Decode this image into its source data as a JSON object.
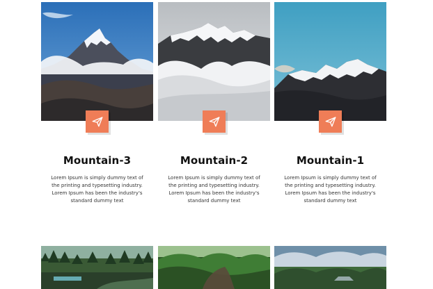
{
  "cards": [
    {
      "title": "Mountain-3",
      "description": "Lorem Ipsum is simply dummy text of the printing and typesetting industry. Lorem Ipsum has been the industry's standard dummy text",
      "image_icon": "mountain-photo",
      "button_icon": "paper-plane-icon"
    },
    {
      "title": "Mountain-2",
      "description": "Lorem Ipsum is simply dummy text of the printing and typesetting industry. Lorem Ipsum has been the industry's standard dummy text",
      "image_icon": "mountain-photo",
      "button_icon": "paper-plane-icon"
    },
    {
      "title": "Mountain-1",
      "description": "Lorem Ipsum is simply dummy text of the printing and typesetting industry. Lorem Ipsum has been the industry's standard dummy text",
      "image_icon": "mountain-photo",
      "button_icon": "paper-plane-icon"
    }
  ],
  "bottom_row": [
    {
      "image_icon": "forest-photo"
    },
    {
      "image_icon": "forest-photo"
    },
    {
      "image_icon": "forest-photo"
    }
  ],
  "colors": {
    "accent": "#ef7d57"
  }
}
